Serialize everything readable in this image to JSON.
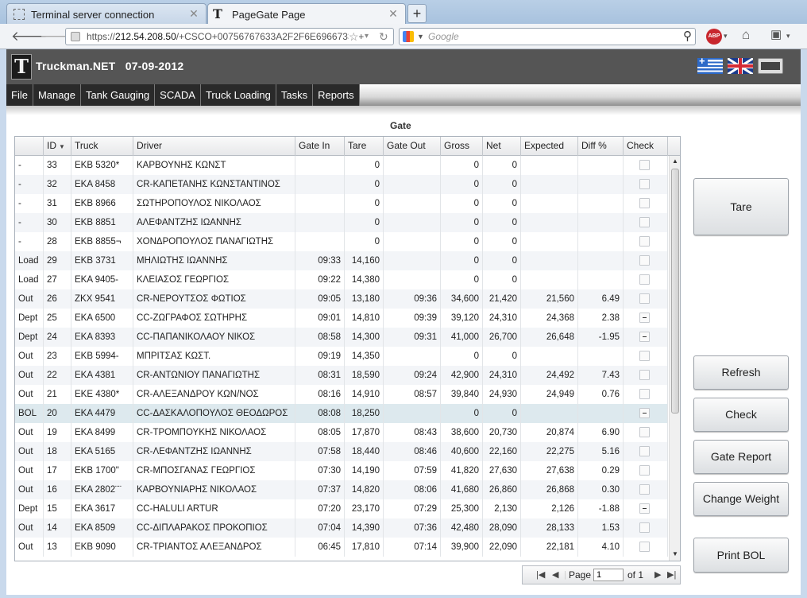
{
  "browser": {
    "tabs": [
      {
        "label": "Terminal server connection"
      },
      {
        "label": "PageGate Page"
      }
    ],
    "url_prefix": "https://",
    "url_host": "212.54.208.50",
    "url_rest": "/+CSCO+00756767633A2F2F6E69667334+",
    "search_placeholder": "Google",
    "abp_label": "ABP"
  },
  "app": {
    "title": "Truckman.NET",
    "date": "07-09-2012",
    "logo_letter": "T"
  },
  "menu": [
    "File",
    "Manage",
    "Tank Gauging",
    "SCADA",
    "Truck Loading",
    "Tasks",
    "Reports"
  ],
  "grid": {
    "title": "Gate",
    "columns": [
      "",
      "ID",
      "Truck",
      "Driver",
      "Gate In",
      "Tare",
      "Gate Out",
      "Gross",
      "Net",
      "Expected",
      "Diff %",
      "Check"
    ],
    "rows": [
      {
        "status": "-",
        "id": "33",
        "truck": "EKB 5320*",
        "driver": "ΚΑΡΒΟΥΝΗΣ ΚΩΝΣΤ",
        "gate_in": "",
        "tare": "0",
        "gate_out": "",
        "gross": "0",
        "net": "0",
        "expected": "",
        "diff": "",
        "check": "empty"
      },
      {
        "status": "-",
        "id": "32",
        "truck": "EKA 8458",
        "driver": "CR-ΚΑΠΕΤΑΝΗΣ ΚΩΝΣΤΑΝΤΙΝΟΣ",
        "gate_in": "",
        "tare": "0",
        "gate_out": "",
        "gross": "0",
        "net": "0",
        "expected": "",
        "diff": "",
        "check": "empty"
      },
      {
        "status": "-",
        "id": "31",
        "truck": "EKB 8966",
        "driver": "ΣΩΤΗΡΟΠΟΥΛΟΣ ΝΙΚΟΛΑΟΣ",
        "gate_in": "",
        "tare": "0",
        "gate_out": "",
        "gross": "0",
        "net": "0",
        "expected": "",
        "diff": "",
        "check": "empty"
      },
      {
        "status": "-",
        "id": "30",
        "truck": "EKB 8851",
        "driver": "ΑΛΕΦΑΝΤΖΗΣ ΙΩΑΝΝΗΣ",
        "gate_in": "",
        "tare": "0",
        "gate_out": "",
        "gross": "0",
        "net": "0",
        "expected": "",
        "diff": "",
        "check": "empty"
      },
      {
        "status": "-",
        "id": "28",
        "truck": "EKB 8855¬",
        "driver": "ΧΟΝΔΡΟΠΟΥΛΟΣ ΠΑΝΑΓΙΩΤΗΣ",
        "gate_in": "",
        "tare": "0",
        "gate_out": "",
        "gross": "0",
        "net": "0",
        "expected": "",
        "diff": "",
        "check": "empty"
      },
      {
        "status": "Load",
        "id": "29",
        "truck": "EKB 3731",
        "driver": "ΜΗΛΙΩΤΗΣ ΙΩΑΝΝΗΣ",
        "gate_in": "09:33",
        "tare": "14,160",
        "gate_out": "",
        "gross": "0",
        "net": "0",
        "expected": "",
        "diff": "",
        "check": "empty"
      },
      {
        "status": "Load",
        "id": "27",
        "truck": "EKA 9405-",
        "driver": "ΚΛΕΙΑΣΟΣ ΓΕΩΡΓΙΟΣ",
        "gate_in": "09:22",
        "tare": "14,380",
        "gate_out": "",
        "gross": "0",
        "net": "0",
        "expected": "",
        "diff": "",
        "check": "empty"
      },
      {
        "status": "Out",
        "id": "26",
        "truck": "ZKX 9541",
        "driver": "CR-ΝΕΡΟΥΤΣΟΣ ΦΩΤΙΟΣ",
        "gate_in": "09:05",
        "tare": "13,180",
        "gate_out": "09:36",
        "gross": "34,600",
        "net": "21,420",
        "expected": "21,560",
        "diff": "6.49",
        "check": "empty"
      },
      {
        "status": "Dept",
        "id": "25",
        "truck": "EKA 6500",
        "driver": "CC-ΖΩΓΡΑΦΟΣ ΣΩΤΗΡΗΣ",
        "gate_in": "09:01",
        "tare": "14,810",
        "gate_out": "09:39",
        "gross": "39,120",
        "net": "24,310",
        "expected": "24,368",
        "diff": "2.38",
        "check": "ind"
      },
      {
        "status": "Dept",
        "id": "24",
        "truck": "EKA 8393",
        "driver": "CC-ΠΑΠΑΝΙΚΟΛΑΟΥ ΝΙΚΟΣ",
        "gate_in": "08:58",
        "tare": "14,300",
        "gate_out": "09:31",
        "gross": "41,000",
        "net": "26,700",
        "expected": "26,648",
        "diff": "-1.95",
        "check": "ind"
      },
      {
        "status": "Out",
        "id": "23",
        "truck": "EKB 5994-",
        "driver": "ΜΠΡΙΤΣΑΣ ΚΩΣΤ.",
        "gate_in": "09:19",
        "tare": "14,350",
        "gate_out": "",
        "gross": "0",
        "net": "0",
        "expected": "",
        "diff": "",
        "check": "empty"
      },
      {
        "status": "Out",
        "id": "22",
        "truck": "EKA 4381",
        "driver": "CR-ΑΝΤΩΝΙΟΥ ΠΑΝΑΓΙΩΤΗΣ",
        "gate_in": "08:31",
        "tare": "18,590",
        "gate_out": "09:24",
        "gross": "42,900",
        "net": "24,310",
        "expected": "24,492",
        "diff": "7.43",
        "check": "empty"
      },
      {
        "status": "Out",
        "id": "21",
        "truck": "EKE 4380*",
        "driver": "CR-ΑΛΕΞΑΝΔΡΟΥ ΚΩΝ/ΝΟΣ",
        "gate_in": "08:16",
        "tare": "14,910",
        "gate_out": "08:57",
        "gross": "39,840",
        "net": "24,930",
        "expected": "24,949",
        "diff": "0.76",
        "check": "empty"
      },
      {
        "status": "BOL",
        "id": "20",
        "truck": "EKA 4479",
        "driver": "CC-ΔΑΣΚΑΛΟΠΟΥΛΟΣ  ΘΕΟΔΩΡΟΣ",
        "gate_in": "08:08",
        "tare": "18,250",
        "gate_out": "",
        "gross": "0",
        "net": "0",
        "expected": "",
        "diff": "",
        "check": "ind"
      },
      {
        "status": "Out",
        "id": "19",
        "truck": "EKA 8499",
        "driver": "CR-ΤΡΟΜΠΟΥΚΗΣ ΝΙΚΟΛΑΟΣ",
        "gate_in": "08:05",
        "tare": "17,870",
        "gate_out": "08:43",
        "gross": "38,600",
        "net": "20,730",
        "expected": "20,874",
        "diff": "6.90",
        "check": "empty"
      },
      {
        "status": "Out",
        "id": "18",
        "truck": "EKA 5165",
        "driver": "CR-ΛΕΦΑΝΤΖΗΣ ΙΩΑΝΝΗΣ",
        "gate_in": "07:58",
        "tare": "18,440",
        "gate_out": "08:46",
        "gross": "40,600",
        "net": "22,160",
        "expected": "22,275",
        "diff": "5.16",
        "check": "empty"
      },
      {
        "status": "Out",
        "id": "17",
        "truck": "EKB 1700\"",
        "driver": "CR-ΜΠΟΣΓΑΝΑΣ ΓΕΩΡΓΙΟΣ",
        "gate_in": "07:30",
        "tare": "14,190",
        "gate_out": "07:59",
        "gross": "41,820",
        "net": "27,630",
        "expected": "27,638",
        "diff": "0.29",
        "check": "empty"
      },
      {
        "status": "Out",
        "id": "16",
        "truck": "EKA 2802¨¨",
        "driver": "ΚΑΡΒΟΥΝΙΑΡΗΣ ΝΙΚΟΛΑΟΣ",
        "gate_in": "07:37",
        "tare": "14,820",
        "gate_out": "08:06",
        "gross": "41,680",
        "net": "26,860",
        "expected": "26,868",
        "diff": "0.30",
        "check": "empty"
      },
      {
        "status": "Dept",
        "id": "15",
        "truck": "EKA 3617",
        "driver": "CC-HALULI ARTUR",
        "gate_in": "07:20",
        "tare": "23,170",
        "gate_out": "07:29",
        "gross": "25,300",
        "net": "2,130",
        "expected": "2,126",
        "diff": "-1.88",
        "check": "ind"
      },
      {
        "status": "Out",
        "id": "14",
        "truck": "EKA 8509",
        "driver": "CC-ΔΙΠΛΑΡΑΚΟΣ ΠΡΟΚΟΠΙΟΣ",
        "gate_in": "07:04",
        "tare": "14,390",
        "gate_out": "07:36",
        "gross": "42,480",
        "net": "28,090",
        "expected": "28,133",
        "diff": "1.53",
        "check": "empty"
      },
      {
        "status": "Out",
        "id": "13",
        "truck": "EKB 9090",
        "driver": "CR-ΤΡΙΑΝΤΟΣ ΑΛΕΞΑΝΔΡΟΣ",
        "gate_in": "06:45",
        "tare": "17,810",
        "gate_out": "07:14",
        "gross": "39,900",
        "net": "22,090",
        "expected": "22,181",
        "diff": "4.10",
        "check": "empty"
      }
    ]
  },
  "pager": {
    "page_label": "Page",
    "page_value": "1",
    "of_label": "of 1"
  },
  "buttons": {
    "tare": "Tare",
    "refresh": "Refresh",
    "check": "Check",
    "gate_report": "Gate Report",
    "change_weight": "Change Weight",
    "print_bol": "Print BOL"
  }
}
